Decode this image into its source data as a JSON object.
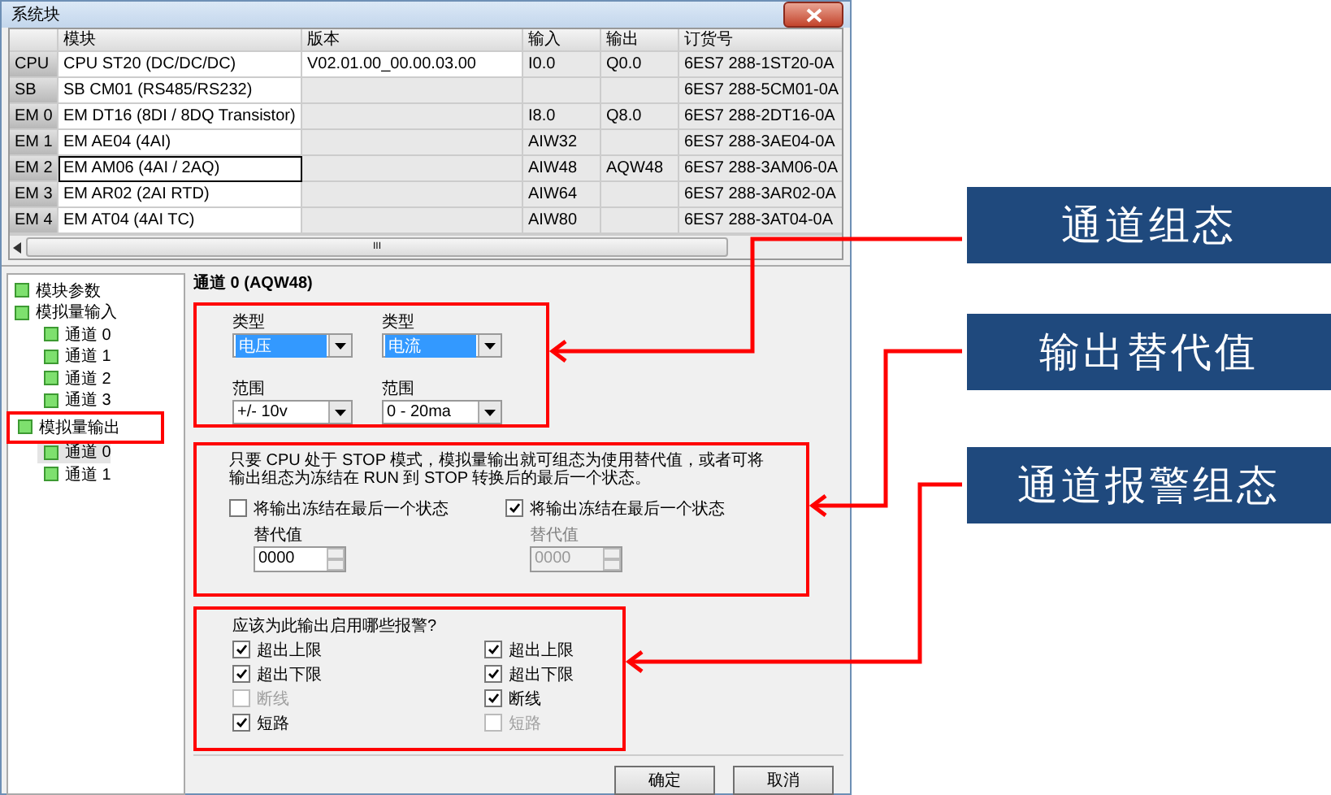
{
  "window": {
    "title": "系统块"
  },
  "table": {
    "columns": [
      "模块",
      "版本",
      "输入",
      "输出",
      "订货号"
    ],
    "rows": [
      {
        "slot": "CPU",
        "module": "CPU ST20 (DC/DC/DC)",
        "version": "V02.01.00_00.00.03.00",
        "input": "I0.0",
        "output": "Q0.0",
        "order": "6ES7 288-1ST20-0A",
        "selected": false
      },
      {
        "slot": "SB",
        "module": "SB CM01 (RS485/RS232)",
        "version": "",
        "input": "",
        "output": "",
        "order": "6ES7 288-5CM01-0A",
        "selected": false
      },
      {
        "slot": "EM 0",
        "module": "EM DT16 (8DI / 8DQ Transistor)",
        "version": "",
        "input": "I8.0",
        "output": "Q8.0",
        "order": "6ES7 288-2DT16-0A",
        "selected": false
      },
      {
        "slot": "EM 1",
        "module": "EM AE04 (4AI)",
        "version": "",
        "input": "AIW32",
        "output": "",
        "order": "6ES7 288-3AE04-0A",
        "selected": false
      },
      {
        "slot": "EM 2",
        "module": "EM AM06 (4AI / 2AQ)",
        "version": "",
        "input": "AIW48",
        "output": "AQW48",
        "order": "6ES7 288-3AM06-0A",
        "selected": true
      },
      {
        "slot": "EM 3",
        "module": "EM AR02 (2AI RTD)",
        "version": "",
        "input": "AIW64",
        "output": "",
        "order": "6ES7 288-3AR02-0A",
        "selected": false
      },
      {
        "slot": "EM 4",
        "module": "EM AT04 (4AI TC)",
        "version": "",
        "input": "AIW80",
        "output": "",
        "order": "6ES7 288-3AT04-0A",
        "selected": false
      }
    ]
  },
  "scrollbar": {
    "grip": "III"
  },
  "tree": [
    {
      "label": "模块参数",
      "selected": false,
      "highlighted": false
    },
    {
      "label": "模拟量输入",
      "selected": false,
      "highlighted": false,
      "children": [
        {
          "label": "通道 0",
          "selected": false,
          "highlighted": false
        },
        {
          "label": "通道 1",
          "selected": false,
          "highlighted": false
        },
        {
          "label": "通道 2",
          "selected": false,
          "highlighted": false
        },
        {
          "label": "通道 3",
          "selected": false,
          "highlighted": false
        }
      ]
    },
    {
      "label": "模拟量输出",
      "selected": false,
      "highlighted": true,
      "children": [
        {
          "label": "通道 0",
          "selected": true,
          "highlighted": false
        },
        {
          "label": "通道 1",
          "selected": false,
          "highlighted": false
        }
      ]
    }
  ],
  "panel": {
    "heading": "通道 0 (AQW48)",
    "config": [
      {
        "type_label": "类型",
        "type_value": "电压",
        "range_label": "范围",
        "range_value": "+/- 10v"
      },
      {
        "type_label": "类型",
        "type_value": "电流",
        "range_label": "范围",
        "range_value": "0 - 20ma"
      }
    ],
    "substitute": {
      "description": "只要 CPU 处于 STOP 模式，模拟量输出就可组态为使用替代值，或者可将输出组态为冻结在 RUN 到 STOP 转换后的最后一个状态。",
      "columns": [
        {
          "freeze_label": "将输出冻结在最后一个状态",
          "checked": false,
          "value_label": "替代值",
          "value": "0000",
          "disabled": false
        },
        {
          "freeze_label": "将输出冻结在最后一个状态",
          "checked": true,
          "value_label": "替代值",
          "value": "0000",
          "disabled": true
        }
      ]
    },
    "alarms": {
      "heading": "应该为此输出启用哪些报警?",
      "columns": [
        [
          {
            "label": "超出上限",
            "checked": true,
            "disabled": false
          },
          {
            "label": "超出下限",
            "checked": true,
            "disabled": false
          },
          {
            "label": "断线",
            "checked": false,
            "disabled": true
          },
          {
            "label": "短路",
            "checked": true,
            "disabled": false
          }
        ],
        [
          {
            "label": "超出上限",
            "checked": true,
            "disabled": false
          },
          {
            "label": "超出下限",
            "checked": true,
            "disabled": false
          },
          {
            "label": "断线",
            "checked": true,
            "disabled": false
          },
          {
            "label": "短路",
            "checked": false,
            "disabled": true
          }
        ]
      ]
    }
  },
  "buttons": [
    "确定",
    "取消"
  ],
  "callouts": [
    "通道组态",
    "输出替代值",
    "通道报警组态"
  ]
}
